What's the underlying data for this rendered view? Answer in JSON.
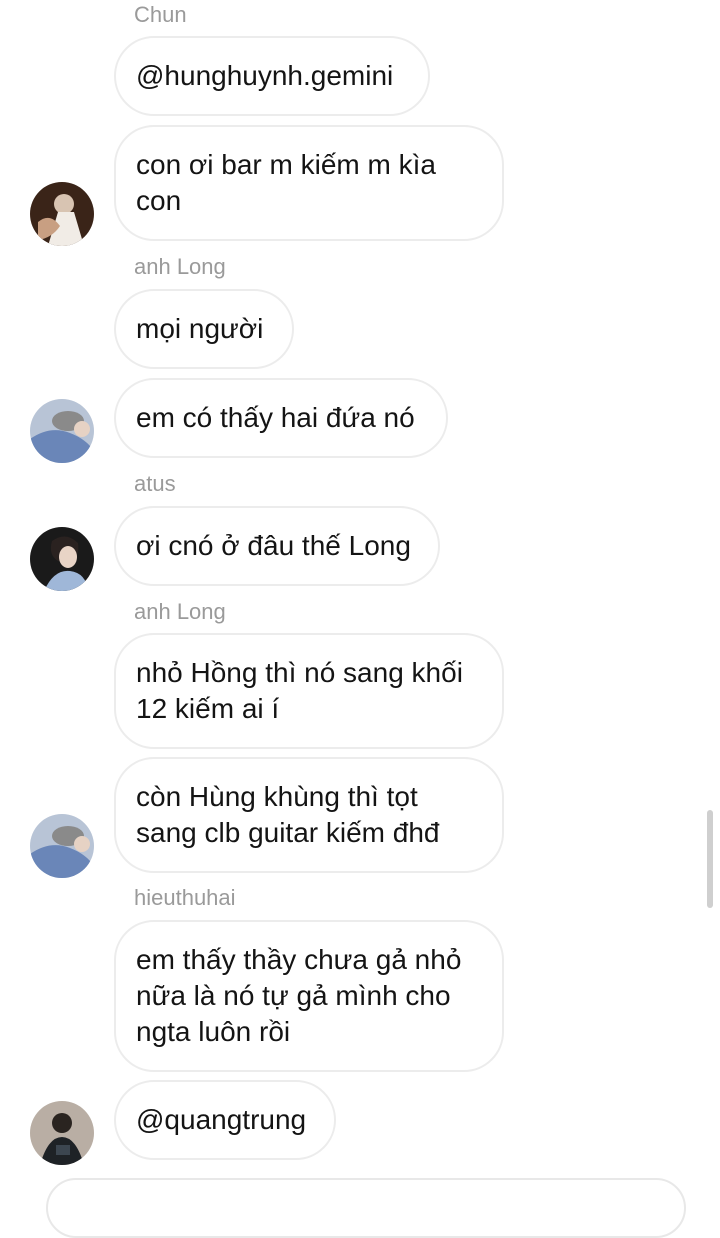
{
  "messages": [
    {
      "sender": "Chun",
      "text": "@hunghuynh.gemini",
      "avatar": null
    },
    {
      "sender": null,
      "text": "con ơi bar m kiếm m kìa\ncon",
      "avatar": "user-avatar-chun"
    },
    {
      "sender": "anh Long",
      "text": "mọi người",
      "avatar": null
    },
    {
      "sender": null,
      "text": "em có thấy hai đứa nó",
      "avatar": "user-avatar-anh-long"
    },
    {
      "sender": "atus",
      "text": "ơi cnó ở đâu thế Long",
      "avatar": "user-avatar-atus"
    },
    {
      "sender": "anh Long",
      "text": "nhỏ Hồng thì nó sang khối\n12 kiếm ai í",
      "avatar": null
    },
    {
      "sender": null,
      "text": "còn Hùng khùng thì tọt\nsang clb guitar kiếm đhđ",
      "avatar": "user-avatar-anh-long"
    },
    {
      "sender": "hieuthuhai",
      "text": "em thấy thầy chưa gả nhỏ\nnữa là nó tự gả mình cho\nngta luôn rồi",
      "avatar": null
    },
    {
      "sender": null,
      "text": "@quangtrung",
      "avatar": "user-avatar-hieuthuhai"
    }
  ],
  "colors": {
    "sender_text": "#9a9a9a",
    "bubble_border": "#ececec",
    "message_text": "#141414",
    "background": "#ffffff"
  }
}
